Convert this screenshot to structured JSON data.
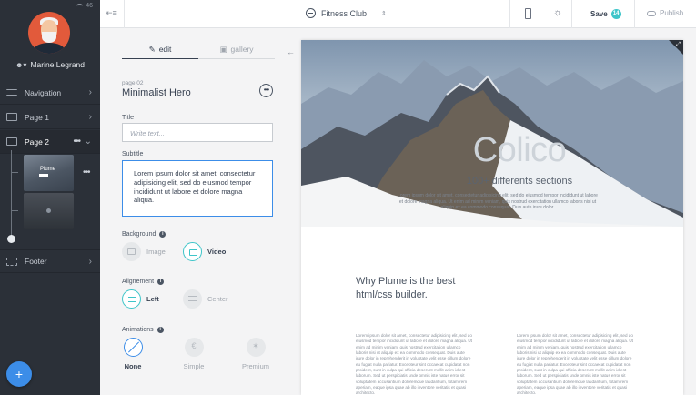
{
  "sidebar": {
    "battery": "46",
    "user_name": "Marine Legrand",
    "nav_navigation": "Navigation",
    "nav_page1": "Page 1",
    "nav_page2": "Page 2",
    "thumb_title": "Plume",
    "nav_footer": "Footer",
    "add_label": "+"
  },
  "toolbar": {
    "site_name": "Fitness Club",
    "save_label": "Save",
    "save_count": "14",
    "publish_label": "Publish"
  },
  "panel": {
    "tab_edit": "edit",
    "tab_gallery": "gallery",
    "page_number": "page 02",
    "page_name": "Minimalist Hero",
    "title_label": "Title",
    "title_placeholder": "Write text...",
    "subtitle_label": "Subtitle",
    "subtitle_value": "Lorem ipsum dolor sit amet, consectetur adipisicing elit, sed do eiusmod tempor incididunt ut labore et dolore magna aliqua.",
    "background_label": "Background",
    "bg_image": "Image",
    "bg_video": "Video",
    "alignment_label": "Alignement",
    "align_left": "Left",
    "align_center": "Center",
    "animations_label": "Animations",
    "anim_none": "None",
    "anim_simple": "Simple",
    "anim_premium": "Premium"
  },
  "preview": {
    "hero_title": "Colico",
    "hero_subtitle": "100+ differents sections",
    "hero_text": "Lorem ipsum dolor sit amet, consectetur adipisicing elit, sed do eiusmod tempor incididunt ut labore et dolore magna aliqua. Ut enim ad minim veniam, quis nostrud exercitation ullamco laboris nisi ut aliquip ex ea commodo consequat. Duis aute irure dolor.",
    "section_heading": "Why Plume is the best html/css builder.",
    "col1_text": "Lorem ipsum dolor sit amet, consectetur adipisicing elit, sed do eiusmod tempor incididunt ut labore et dolore magna aliqua. Ut enim ad minim veniam, quis nostrud exercitation ullamco laboris nisi ut aliquip ex ea commodo consequat. Duis aute irure dolor in reprehenderit in voluptate velit esse cillum dolore eu fugiat nulla pariatur. Excepteur sint occaecat cupidatat non proident, sunt in culpa qui officia deserunt mollit anim id est laborum. Sed ut perspiciatis unde omnis iste natus error sit voluptatem accusantium doloremque laudantium, totam rem aperiam, eaque ipsa quae ab illo inventore veritatis et quasi architecto.",
    "col2_text": "Lorem ipsum dolor sit amet, consectetur adipisicing elit, sed do eiusmod tempor incididunt ut labore et dolore magna aliqua. Ut enim ad minim veniam, quis nostrud exercitation ullamco laboris nisi ut aliquip ex ea commodo consequat. Duis aute irure dolor in reprehenderit in voluptate velit esse cillum dolore eu fugiat nulla pariatur. Excepteur sint occaecat cupidatat non proident, sunt in culpa qui officia deserunt mollit anim id est laborum. Sed ut perspiciatis unde omnis iste natus error sit voluptatem accusantium doloremque laudantium, totam rem aperiam, eaque ipsa quae ab illo inventore veritatis et quasi architecto."
  },
  "colors": {
    "sidebar_bg": "#2b3038",
    "accent_teal": "#3ec5c9",
    "accent_blue": "#3c8de8"
  },
  "icons": [
    "wifi-icon",
    "user-icon",
    "navigation-icon",
    "page-icon",
    "footer-icon",
    "collapse-icon",
    "site-logo-icon",
    "device-icon",
    "brightness-icon",
    "cloud-icon",
    "pencil-icon",
    "gallery-icon",
    "info-icon",
    "more-icon",
    "image-icon",
    "video-icon",
    "align-left-icon",
    "align-center-icon",
    "expand-icon"
  ]
}
